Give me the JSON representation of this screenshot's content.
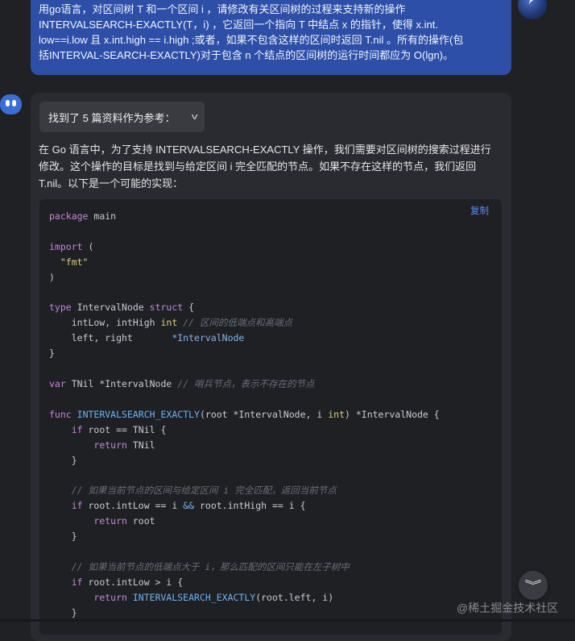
{
  "user_message": {
    "lines": [
      "用go语言，对区间树 T 和一个区间 i ，请修改有关区间树的过程来支持新的操作",
      "INTERVALSEARCH-EXACTLY(T，i) ，它返回一个指向 T 中结点 x 的指针，使得 x.int.",
      "low==i.low 且 x.int.high == i.high ;或者，如果不包含这样的区间时返回 T.nil 。所有的操作(包",
      "括INTERVAL-SEARCH-EXACTLY)对于包含 n 个结点的区间树的运行时间都应为 O(lgn)。"
    ]
  },
  "references_label": "找到了 5 篇资料作为参考：",
  "answer_intro": {
    "lines": [
      "在 Go 语言中，为了支持 INTERVALSEARCH-EXACTLY 操作，我们需要对区间树的搜索过程进行",
      "修改。这个操作的目标是找到与给定区间 i 完全匹配的节点。如果不存在这样的节点，我们返回",
      "T.nil。以下是一个可能的实现："
    ]
  },
  "copy_label": "复制",
  "code_lines": [
    [
      {
        "t": "package",
        "c": "kw"
      },
      {
        "t": " main"
      }
    ],
    [],
    [
      {
        "t": "import",
        "c": "kw"
      },
      {
        "t": " ("
      }
    ],
    [
      {
        "t": "  "
      },
      {
        "t": "\"fmt\"",
        "c": "str"
      }
    ],
    [
      {
        "t": ")"
      }
    ],
    [],
    [
      {
        "t": "type",
        "c": "kw"
      },
      {
        "t": " IntervalNode "
      },
      {
        "t": "struct",
        "c": "kw"
      },
      {
        "t": " {"
      }
    ],
    [
      {
        "t": "    intLow, intHigh "
      },
      {
        "t": "int",
        "c": "num"
      },
      {
        "t": " "
      },
      {
        "t": "// 区间的低端点和高端点",
        "c": "cm"
      }
    ],
    [
      {
        "t": "    left, right       "
      },
      {
        "t": "*IntervalNode",
        "c": "ty"
      }
    ],
    [
      {
        "t": "}"
      }
    ],
    [],
    [
      {
        "t": "var",
        "c": "kw"
      },
      {
        "t": " TNil *IntervalNode "
      },
      {
        "t": "// 哨兵节点，表示不存在的节点",
        "c": "cm"
      }
    ],
    [],
    [
      {
        "t": "func",
        "c": "kw"
      },
      {
        "t": " "
      },
      {
        "t": "INTERVALSEARCH_EXACTLY",
        "c": "fn"
      },
      {
        "t": "(root *IntervalNode, i "
      },
      {
        "t": "int",
        "c": "num"
      },
      {
        "t": ") *IntervalNode {"
      }
    ],
    [
      {
        "t": "    "
      },
      {
        "t": "if",
        "c": "kw"
      },
      {
        "t": " root == TNil {"
      }
    ],
    [
      {
        "t": "        "
      },
      {
        "t": "return",
        "c": "kw"
      },
      {
        "t": " TNil"
      }
    ],
    [
      {
        "t": "    }"
      }
    ],
    [],
    [
      {
        "t": "    "
      },
      {
        "t": "// 如果当前节点的区间与给定区间 i 完全匹配，返回当前节点",
        "c": "cm"
      }
    ],
    [
      {
        "t": "    "
      },
      {
        "t": "if",
        "c": "kw"
      },
      {
        "t": " root.intLow == i "
      },
      {
        "t": "&&",
        "c": "fn"
      },
      {
        "t": " root.intHigh == i {"
      }
    ],
    [
      {
        "t": "        "
      },
      {
        "t": "return",
        "c": "kw"
      },
      {
        "t": " root"
      }
    ],
    [
      {
        "t": "    }"
      }
    ],
    [],
    [
      {
        "t": "    "
      },
      {
        "t": "// 如果当前节点的低端点大于 i，那么匹配的区间只能在左子树中",
        "c": "cm"
      }
    ],
    [
      {
        "t": "    "
      },
      {
        "t": "if",
        "c": "kw"
      },
      {
        "t": " root.intLow > i {"
      }
    ],
    [
      {
        "t": "        "
      },
      {
        "t": "return",
        "c": "kw"
      },
      {
        "t": " "
      },
      {
        "t": "INTERVALSEARCH_EXACTLY",
        "c": "fn"
      },
      {
        "t": "(root.left, i)"
      }
    ],
    [
      {
        "t": "    }"
      }
    ]
  ],
  "scroll_button_glyph": "︾",
  "watermark": "@稀土掘金技术社区",
  "icons": {
    "user_avatar": "user-avatar-icon",
    "bot_avatar": "bot-avatar-icon",
    "chevron": "chevron-down-icon",
    "scroll_down": "double-chevron-down-icon"
  },
  "colors": {
    "background": "#202125",
    "user_bubble": "#2d4fa7",
    "bot_panel": "#2a2b30",
    "code_bg": "#1f2024",
    "accent_link": "#5b8cf2",
    "keyword": "#c487d8",
    "comment": "#6b6e78"
  }
}
